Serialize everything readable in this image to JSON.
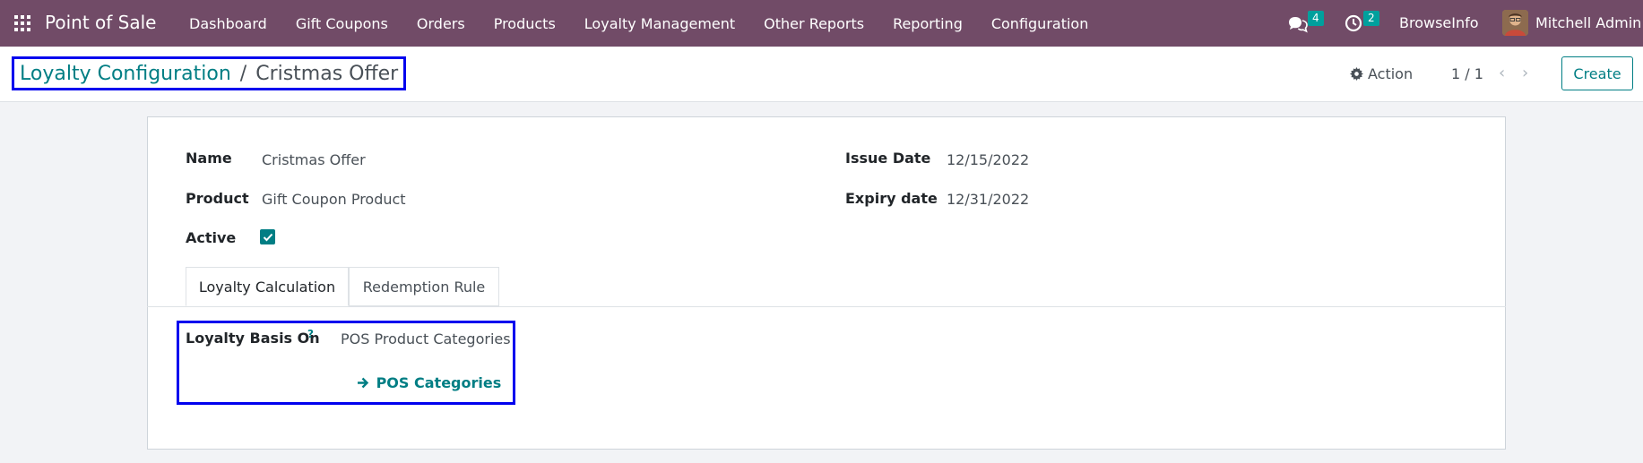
{
  "navbar": {
    "app_title": "Point of Sale",
    "menu": [
      "Dashboard",
      "Gift Coupons",
      "Orders",
      "Products",
      "Loyalty Management",
      "Other Reports",
      "Reporting",
      "Configuration"
    ],
    "messages_count": "4",
    "activities_count": "2",
    "company": "BrowseInfo",
    "user": "Mitchell Admin"
  },
  "control": {
    "breadcrumb_parent": "Loyalty Configuration",
    "breadcrumb_sep": "/",
    "breadcrumb_current": "Cristmas Offer",
    "action_label": "Action",
    "pager": "1 / 1",
    "create_label": "Create"
  },
  "form": {
    "name_label": "Name",
    "name_value": "Cristmas Offer",
    "product_label": "Product",
    "product_value": "Gift Coupon Product",
    "active_label": "Active",
    "active_checked": true,
    "issue_date_label": "Issue Date",
    "issue_date_value": "12/15/2022",
    "expiry_date_label": "Expiry date",
    "expiry_date_value": "12/31/2022"
  },
  "tabs": [
    "Loyalty Calculation",
    "Redemption Rule"
  ],
  "loyalty": {
    "basis_label": "Loyalty Basis On",
    "help_mark": "?",
    "basis_value": "POS Product Categories",
    "categories_button": "POS Categories"
  },
  "colors": {
    "navbar": "#714b67",
    "accent": "#017e84",
    "badge": "#00a09d",
    "highlight_border": "#0000ee"
  }
}
